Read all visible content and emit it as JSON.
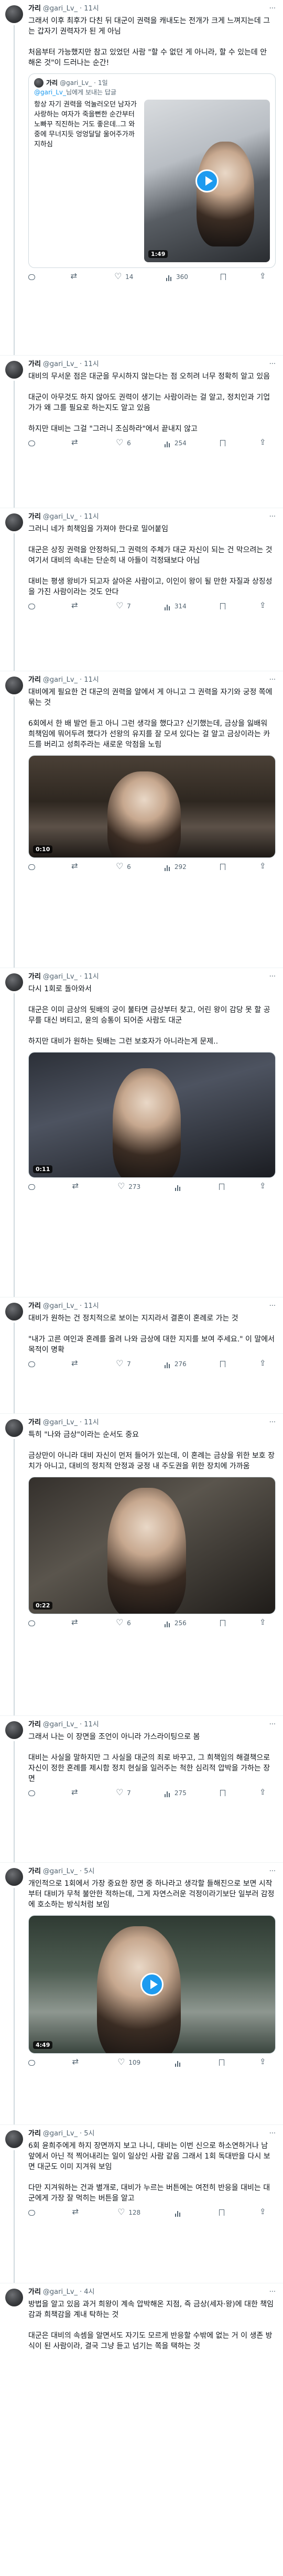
{
  "tweets": [
    {
      "name": "가리",
      "handle": "@gari_Lv_",
      "time": "11시",
      "body": "그래서 이후 최후가 다친 뒤 대군이 권력을 캐내도는 전개가 크게 느껴지는데 그는 갑자기 권력자가 된 게 아님\n\n처음부터 가능했지만 참고 있었던 사람 \"할 수 없던 게 아니라, 할 수 있는데 안 해온 것\"이 드러나는 순간!",
      "quote": {
        "name": "가리",
        "handle": "@gari_Lv_",
        "time": "1일",
        "reply_to_prefix": "",
        "reply_to_user": "@gari_Lv_",
        "reply_to_suffix": "님에게 보내는 답글",
        "body": "항상 자기 권력을 억눌러오던 남자가 사랑하는 여자가 죽을뻔한 순간부터 노빠꾸 직진하는 거도 좋은데..그 와중에 무너지듯 엉엉달달 울어주가까지하심",
        "duration": "1:49"
      },
      "stats": {
        "replies": "",
        "retweets": "",
        "likes": "14",
        "views": "360",
        "bookmark": "",
        "share": ""
      }
    },
    {
      "name": "가리",
      "handle": "@gari_Lv_",
      "time": "11시",
      "body": "대비의 무서운 점은 대군을 무시하지 않는다는 점 오히려 너무 정확히 알고 있음\n\n대군이 아무것도 하지 않아도 권력이 생기는 사람이라는 걸 알고, 정치인과 기업가가 왜 그를 필요로 하는지도 알고 있음\n\n하지만 대비는 그걸 \"그러니 조심하라\"에서 끝내지 않고",
      "stats": {
        "replies": "",
        "retweets": "",
        "likes": "6",
        "views": "254",
        "bookmark": "",
        "share": ""
      }
    },
    {
      "name": "가리",
      "handle": "@gari_Lv_",
      "time": "11시",
      "body": "그러니 네가 희책임을 가져야 한다로 밀어붙임\n\n대군은 상징 권력을 안정하되,그 권력의 주체가 대군 자신이 되는 건 막으려는 것 여기서 대비의 속내는 단순히 내 아들이 걱정돼보다 아님\n\n대비는 평생 왕비가 되고자 살아온 사람이고, 이인이 왕이 될 만한 자질과 상징성을 가진 사람이라는 것도 안다",
      "stats": {
        "replies": "",
        "retweets": "",
        "likes": "7",
        "views": "314",
        "bookmark": "",
        "share": ""
      }
    },
    {
      "name": "가리",
      "handle": "@gari_Lv_",
      "time": "11시",
      "body": "대비에게 필요한 건 대군의 권력을 알에서 게 아니고 그 권력을 자기와 궁정 쪽에 묶는 것\n\n6회에서 한 배 발언 듣고 아니 그런 생각을 했다고? 신기했는데, 금상을 잃배워 희책임에 뭐어두려 했다가 선왕의 유지를 잘 모셔 있다는 걸 알고 금상이라는 카드를 버리고 성희주라는 새로운 악점을 노림",
      "duration": "0:10",
      "stats": {
        "replies": "",
        "retweets": "",
        "likes": "6",
        "views": "292",
        "bookmark": "",
        "share": ""
      }
    },
    {
      "name": "가리",
      "handle": "@gari_Lv_",
      "time": "11시",
      "body": "다시 1회로 돌아와서\n\n대군은 이미 금상의 뒷배의 궁이 불타면 금상부터 찾고, 어린 왕이 감당 못 할 공무를 대신 버티고, 윤의 승통이 되어준 사람도 대군\n\n하지만 대비가 원하는 뒷배는 그런 보호자가 아니라는게 문제..",
      "duration": "0:11",
      "stats": {
        "replies": "",
        "retweets": "",
        "likes": "273",
        "views": "",
        "bookmark": "",
        "share": ""
      }
    },
    {
      "name": "가리",
      "handle": "@gari_Lv_",
      "time": "11시",
      "body": "대비가 원하는 건 정치적으로 보이는 지지라서 결혼이 혼례로 가는 것\n\n\"내가 고른 여인과 혼례를 올려 나와 금상에 대한 지지를 보여 주세요.\" 이 말에서 목적이 명확",
      "stats": {
        "replies": "",
        "retweets": "",
        "likes": "7",
        "views": "276",
        "bookmark": "",
        "share": ""
      }
    },
    {
      "name": "가리",
      "handle": "@gari_Lv_",
      "time": "11시",
      "body": "특히 \"나와 금상\"이라는 순서도 중요\n\n금상만이 아니라 대비 자신이 먼저 들어가 있는데, 이 혼례는 금상을 위한 보호 장치가 아니고, 대비의 정치적 안정과 궁정 내 주도권을 위한 장치에 가까움",
      "duration": "0:22",
      "stats": {
        "replies": "",
        "retweets": "",
        "likes": "6",
        "views": "256",
        "bookmark": "",
        "share": ""
      }
    },
    {
      "name": "가리",
      "handle": "@gari_Lv_",
      "time": "11시",
      "body": "그래서 나는 이 장면을 조언이 아니라 가스라이팅으로 봄\n\n대비는 사실을 말하지만 그 사실을 대군의 죄로 바꾸고, 그 희책임의 해결책으로 자신이 정한 혼례를 제시함 정치 현실을 일러주는 척한 심리적 압박을 가하는 장면",
      "stats": {
        "replies": "",
        "retweets": "",
        "likes": "7",
        "views": "275",
        "bookmark": "",
        "share": ""
      }
    },
    {
      "name": "가리",
      "handle": "@gari_Lv_",
      "time": "5시",
      "body": "개인적으로 1회에서 가장 중요한 장면 중 하나라고 생각할 들해진으로 보면 시작부터 대비가 무척 불안한 적하는데, 그게 자연스러운 걱정이라기보단 일부러 감정에 호소하는 방식처럼 보임",
      "duration": "4:49",
      "stats": {
        "replies": "",
        "retweets": "",
        "likes": "109",
        "views": "",
        "bookmark": "",
        "share": ""
      }
    },
    {
      "name": "가리",
      "handle": "@gari_Lv_",
      "time": "5시",
      "body": "6회 윤희주에게 하지 장면까지 보고 나니, 대비는 이번 신으로 하소연하거나 남 앞에서 아닌 적 찍어내리는 일이 일상인 사람 같음 그래서 1회 독대반을 다시 보면 대군도 이미 지겨워 보임\n\n다만 지겨워하는 건과 별개로, 대비가 누르는 버튼에는 여전히 반응을 대비는 대군에게 가장 잘 먹히는 버튼을 알고",
      "stats": {
        "replies": "",
        "retweets": "",
        "likes": "128",
        "views": "",
        "bookmark": "",
        "share": ""
      }
    },
    {
      "name": "가리",
      "handle": "@gari_Lv_",
      "time": "4시",
      "body": "방법을 알고 있음 과거 희왕이 계속 압박해온 지점, 즉 금상(세자·왕)에 대한 책임감과 희책감을 계내 탁하는 것\n\n대군은 대비의 속셈을 알면서도 자기도 모르게 반응할 수밖에 없는 거 이 생존 방식이 된 사람이라, 결국 그냥 듣고 넘기는 쪽을 택하는 것",
      "stats": {
        "replies": "",
        "retweets": "",
        "likes": "",
        "views": "",
        "bookmark": "",
        "share": ""
      }
    }
  ]
}
